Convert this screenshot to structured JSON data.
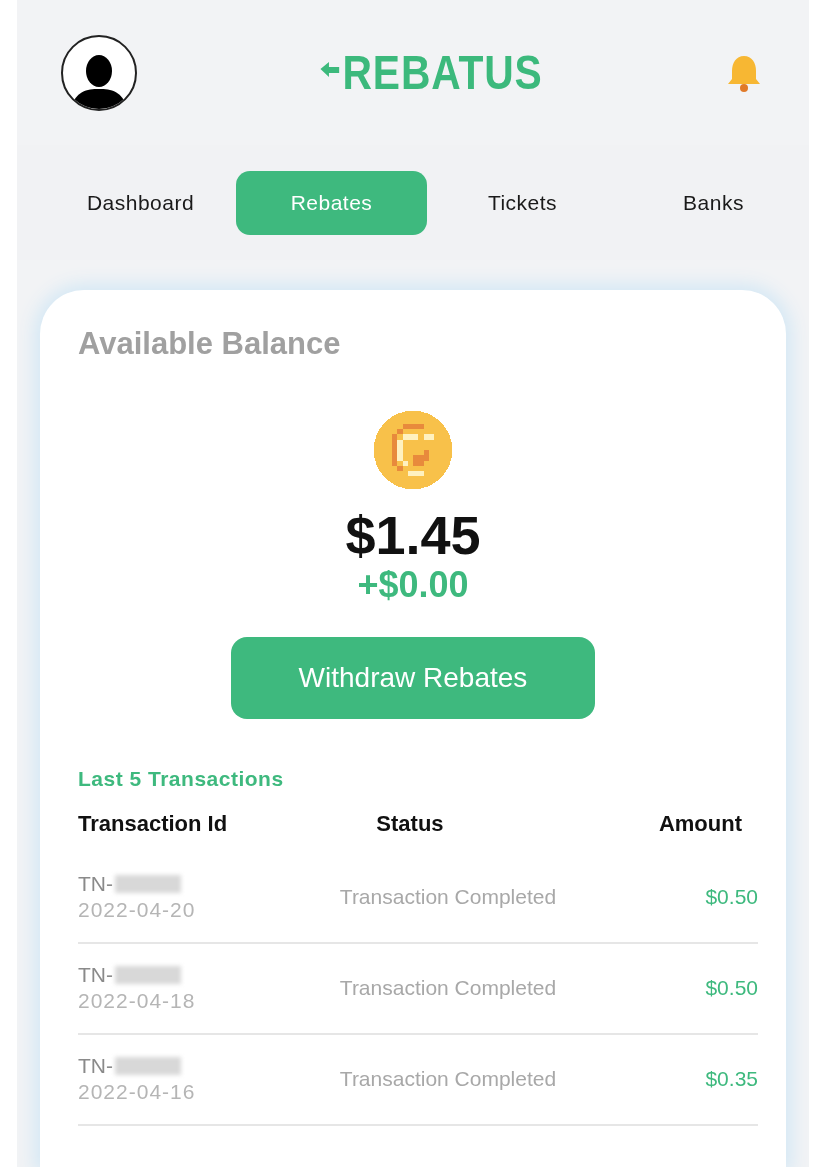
{
  "header": {
    "logo": "REBATUS"
  },
  "tabs": [
    {
      "label": "Dashboard",
      "selected": false
    },
    {
      "label": "Rebates",
      "selected": true
    },
    {
      "label": "Tickets",
      "selected": false
    },
    {
      "label": "Banks",
      "selected": false
    }
  ],
  "balance": {
    "title": "Available Balance",
    "amount": "$1.45",
    "change": "+$0.00",
    "button": "Withdraw Rebates"
  },
  "transactions": {
    "title": "Last 5 Transactions",
    "columns": [
      "Transaction Id",
      "Status",
      "Amount"
    ],
    "rows": [
      {
        "id": "TN-",
        "date": "2022-04-20",
        "status": "Transaction Completed",
        "amount": "$0.50"
      },
      {
        "id": "TN-",
        "date": "2022-04-18",
        "status": "Transaction Completed",
        "amount": "$0.50"
      },
      {
        "id": "TN-",
        "date": "2022-04-16",
        "status": "Transaction Completed",
        "amount": "$0.35"
      }
    ]
  }
}
